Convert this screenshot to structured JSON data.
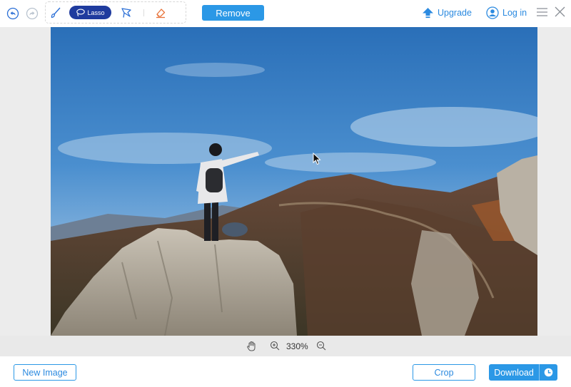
{
  "toolbar": {
    "undo_icon": "undo-icon",
    "redo_icon": "redo-icon",
    "tools": {
      "brush_icon": "brush-icon",
      "lasso_label": "Lasso",
      "polygon_lasso_icon": "polygon-lasso-icon",
      "eraser_icon": "eraser-icon"
    },
    "remove_label": "Remove",
    "upgrade_label": "Upgrade",
    "login_label": "Log in",
    "menu_icon": "hamburger-menu-icon",
    "close_icon": "close-icon"
  },
  "canvas": {
    "image_description_icon": "photo",
    "cursor_icon": "mouse-pointer-icon"
  },
  "zoom": {
    "hand_icon": "hand-pan-icon",
    "zoom_in_icon": "zoom-in-icon",
    "level": "330%",
    "zoom_out_icon": "zoom-out-icon"
  },
  "footer": {
    "new_image_label": "New Image",
    "crop_label": "Crop",
    "download_label": "Download",
    "history_icon": "clock-icon"
  },
  "colors": {
    "accent": "#2b98e6",
    "lasso_active": "#1f3b9e",
    "canvas_bg": "#ececec"
  }
}
